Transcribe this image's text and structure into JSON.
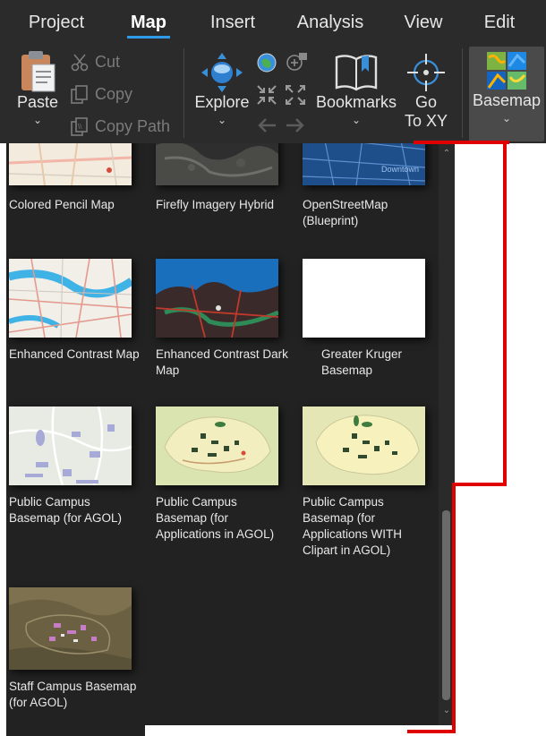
{
  "tabs": [
    "Project",
    "Map",
    "Insert",
    "Analysis",
    "View",
    "Edit"
  ],
  "active_tab": "Map",
  "ribbon": {
    "paste": "Paste",
    "cut": "Cut",
    "copy": "Copy",
    "copy_path": "Copy Path",
    "explore": "Explore",
    "bookmarks": "Bookmarks",
    "go_to_xy_line1": "Go",
    "go_to_xy_line2": "To XY",
    "basemap": "Basemap"
  },
  "basemaps": [
    {
      "name": "Colored Pencil Map",
      "thumb": "colored-pencil"
    },
    {
      "name": "Firefly Imagery Hybrid",
      "thumb": "firefly"
    },
    {
      "name": "OpenStreetMap (Blueprint)",
      "thumb": "blueprint"
    },
    {
      "name": "Enhanced Contrast Map",
      "thumb": "enhanced-contrast"
    },
    {
      "name": "Enhanced Contrast Dark Map",
      "thumb": "enhanced-dark"
    },
    {
      "name": "Greater Kruger Basemap",
      "thumb": "blank"
    },
    {
      "name": "Public Campus Basemap (for AGOL)",
      "thumb": "campus-light"
    },
    {
      "name": "Public Campus Basemap (for Applications in AGOL)",
      "thumb": "campus-green"
    },
    {
      "name": "Public Campus Basemap (for Applications WITH Clipart in AGOL)",
      "thumb": "campus-yellow"
    },
    {
      "name": "Staff Campus Basemap (for AGOL)",
      "thumb": "campus-satellite"
    }
  ],
  "colors": {
    "ribbon_bg": "#2b2b2b",
    "gallery_bg": "#222222",
    "accent": "#2f9ae8",
    "annotation_red": "#e00000"
  }
}
